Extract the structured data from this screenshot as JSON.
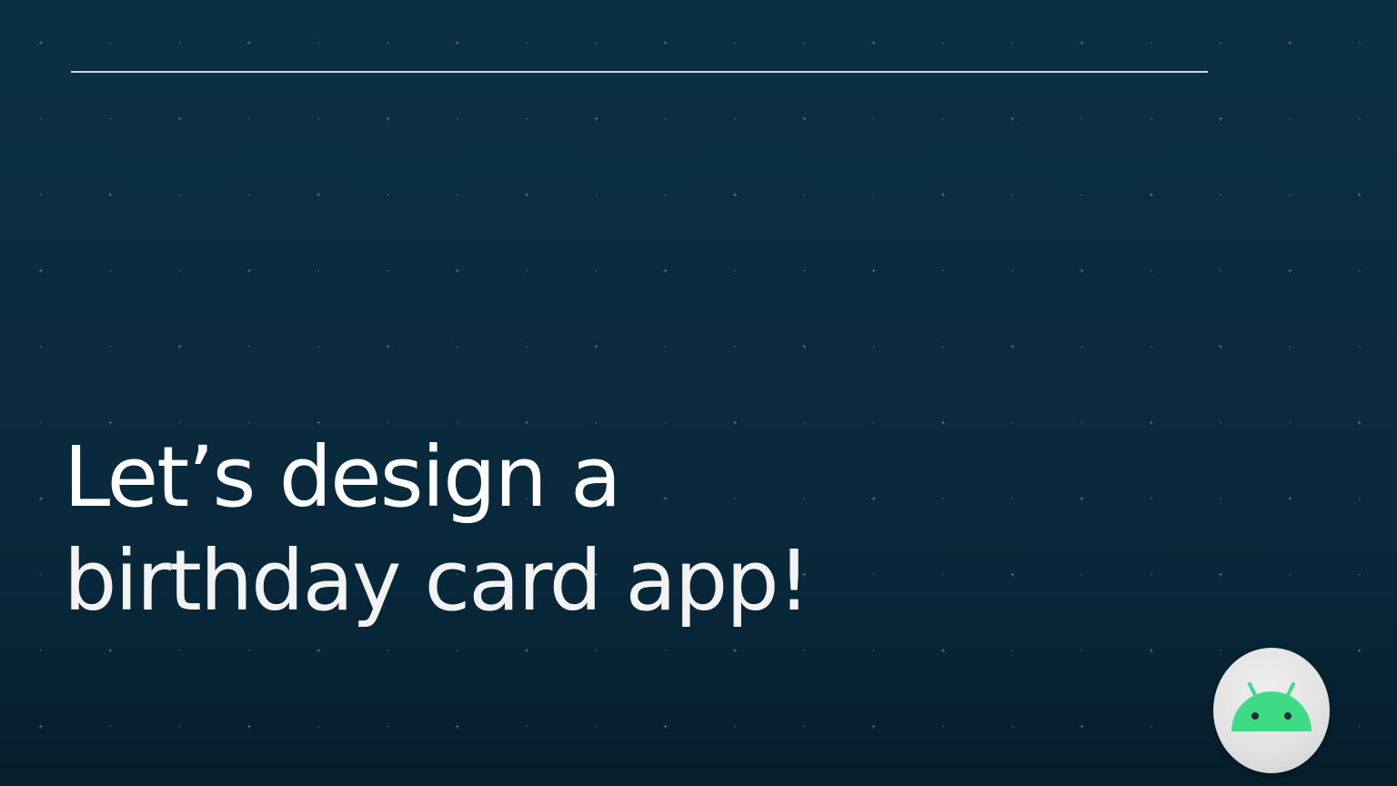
{
  "slide": {
    "headline_line1": "Let’s design a",
    "headline_line2": "birthday card app!"
  },
  "badge": {
    "icon": "android-robot-icon"
  },
  "colors": {
    "background": "#0a2b3e",
    "text": "#ffffff",
    "rule": "#cfd8dc",
    "android_green": "#3ddc84",
    "badge_bg": "#e3e3e3"
  }
}
